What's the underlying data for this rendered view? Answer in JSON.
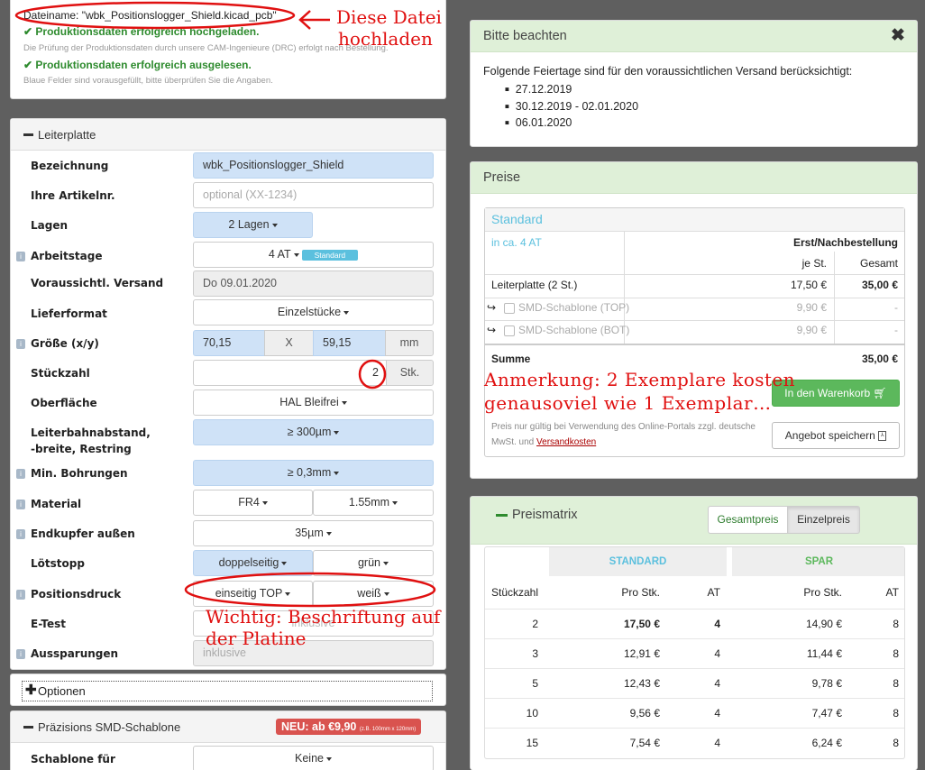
{
  "upload": {
    "filename": "Dateiname: \"wbk_Positionslogger_Shield.kicad_pcb\"",
    "status1": "Produktionsdaten erfolgreich hochgeladen.",
    "note1": "Die Prüfung der Produktionsdaten durch unsere CAM-Ingenieure (DRC) erfolgt nach Bestellung.",
    "status2": "Produktionsdaten erfolgreich ausgelesen.",
    "note2": "Blaue Felder sind vorausgefüllt, bitte überprüfen Sie die Angaben."
  },
  "pcb": {
    "section_title": "Leiterplatte",
    "fields": {
      "bezeichnung": {
        "label": "Bezeichnung",
        "value": "wbk_Positionslogger_Shield"
      },
      "artikelnr": {
        "label": "Ihre Artikelnr.",
        "placeholder": "optional (XX-1234)"
      },
      "lagen": {
        "label": "Lagen",
        "value": "2 Lagen"
      },
      "arbeitstage": {
        "label": "Arbeitstage",
        "value": "4 AT",
        "badge": "Standard"
      },
      "versand": {
        "label": "Voraussichtl. Versand",
        "value": "Do 09.01.2020"
      },
      "lieferformat": {
        "label": "Lieferformat",
        "value": "Einzelstücke"
      },
      "groesse": {
        "label": "Größe (x/y)",
        "x": "70,15",
        "sep": "X",
        "y": "59,15",
        "unit": "mm"
      },
      "stueckzahl": {
        "label": "Stückzahl",
        "value": "2",
        "unit": "Stk."
      },
      "oberflaeche": {
        "label": "Oberfläche",
        "value": "HAL Bleifrei"
      },
      "leiterbahn": {
        "label1": "Leiterbahnabstand,",
        "label2": "-breite, Restring",
        "value": "≥ 300µm"
      },
      "bohrungen": {
        "label": "Min. Bohrungen",
        "value": "≥ 0,3mm"
      },
      "material": {
        "label": "Material",
        "value1": "FR4",
        "value2": "1.55mm"
      },
      "endkupfer": {
        "label": "Endkupfer außen",
        "value": "35µm"
      },
      "loetstopp": {
        "label": "Lötstopp",
        "value1": "doppelseitig",
        "value2": "grün"
      },
      "positionsdruck": {
        "label": "Positionsdruck",
        "value1": "einseitig TOP",
        "value2": "weiß"
      },
      "etest": {
        "label": "E-Test",
        "value": "inklusive"
      },
      "aussparungen": {
        "label": "Aussparungen",
        "value": "inklusive"
      }
    }
  },
  "options": {
    "title": "Optionen"
  },
  "smd": {
    "title": "Präzisions SMD-Schablone",
    "badge_main": "NEU: ab €9,90",
    "badge_small": "(z.B. 100mm x 120mm)",
    "schablone_label": "Schablone für",
    "schablone_value": "Keine"
  },
  "notice": {
    "title": "Bitte beachten",
    "intro": "Folgende Feiertage sind für den voraussichtlichen Versand berücksichtigt:",
    "dates": [
      "27.12.2019",
      "30.12.2019 - 02.01.2020",
      "06.01.2020"
    ]
  },
  "prices": {
    "title": "Preise",
    "plan": "Standard",
    "eta": "in ca. 4 AT",
    "col_group": "Erst/Nachbestellung",
    "col_each": "je St.",
    "col_total": "Gesamt",
    "rows": [
      {
        "label": "Leiterplatte (2 St.)",
        "each": "17,50 €",
        "total": "35,00 €"
      },
      {
        "label": "SMD-Schablone (TOP)",
        "each": "9,90 €",
        "total": "-"
      },
      {
        "label": "SMD-Schablone (BOT)",
        "each": "9,90 €",
        "total": "-"
      }
    ],
    "sum_label": "Summe",
    "sum_value": "35,00 €",
    "cart_button": "In den Warenkorb",
    "save_button": "Angebot speichern",
    "footnote": "Preis nur gültig bei Verwendung des Online-Portals zzgl. deutsche MwSt. und",
    "shipping_link": "Versandkosten"
  },
  "matrix": {
    "title": "Preismatrix",
    "tab_total": "Gesamtpreis",
    "tab_each": "Einzelpreis",
    "group_std": "STANDARD",
    "group_spar": "SPAR",
    "col_qty": "Stückzahl",
    "col_price": "Pro Stk.",
    "col_at": "AT",
    "rows": [
      {
        "qty": "2",
        "std": "17,50 €",
        "std_at": "4",
        "spar": "14,90 €",
        "spar_at": "8"
      },
      {
        "qty": "3",
        "std": "12,91 €",
        "std_at": "4",
        "spar": "11,44 €",
        "spar_at": "8"
      },
      {
        "qty": "5",
        "std": "12,43 €",
        "std_at": "4",
        "spar": "9,78 €",
        "spar_at": "8"
      },
      {
        "qty": "10",
        "std": "9,56 €",
        "std_at": "4",
        "spar": "7,47 €",
        "spar_at": "8"
      },
      {
        "qty": "15",
        "std": "7,54 €",
        "std_at": "4",
        "spar": "6,24 €",
        "spar_at": "8"
      }
    ]
  },
  "annotations": {
    "upload_hint_1": "Diese Datei",
    "upload_hint_2": "hochladen",
    "note_1": "Anmerkung: 2 Exemplare kosten",
    "note_2": "genausoviel wie 1 Exemplar…",
    "important_1": "Wichtig: Beschriftung auf",
    "important_2": "der Platine"
  },
  "colors": {
    "accent_green": "#2e8b2e",
    "info_blue": "#5bc0de",
    "field_blue": "#cfe2f7",
    "annotation_red": "#e01010",
    "cart_green": "#5cb85c",
    "badge_red": "#d9534f"
  }
}
